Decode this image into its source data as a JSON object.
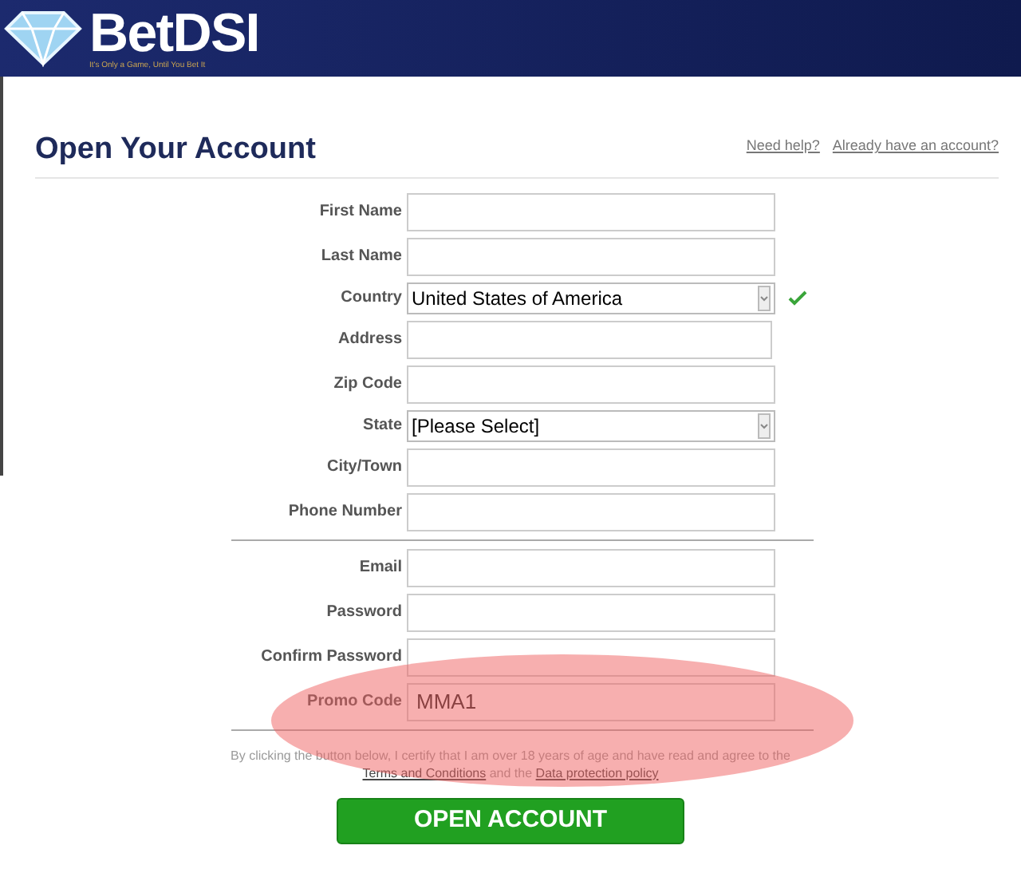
{
  "header": {
    "brand": "BetDSI",
    "tagline": "It's Only a Game, Until You Bet It"
  },
  "title": "Open Your Account",
  "links": [
    "Need help?",
    "Already have an account?"
  ],
  "groups": [
    [
      {
        "label": "First Name",
        "kind": "text"
      },
      {
        "label": "Last Name",
        "kind": "text"
      },
      {
        "label": "Country",
        "kind": "select",
        "value": "United States of America",
        "valid": true
      },
      {
        "label": "Address",
        "kind": "textarea"
      },
      {
        "label": "Zip Code",
        "kind": "text"
      },
      {
        "label": "State",
        "kind": "select",
        "value": "[Please Select]",
        "valid": false
      },
      {
        "label": "City/Town",
        "kind": "text"
      },
      {
        "label": "Phone Number",
        "kind": "text"
      }
    ],
    [
      {
        "label": "Email",
        "kind": "text"
      },
      {
        "label": "Password",
        "kind": "text"
      },
      {
        "label": "Confirm Password",
        "kind": "text"
      },
      {
        "label": "Promo Code",
        "kind": "text",
        "value": "MMA1"
      }
    ]
  ],
  "disclaimer": [
    {
      "kind": "text",
      "text": "By clicking the button below, I certify that I am over 18 years of age and have read and agree to the"
    },
    {
      "kind": "link",
      "text": "Terms and Conditions"
    },
    {
      "kind": "text",
      "text": "and the"
    },
    {
      "kind": "link",
      "text": "Data protection policy"
    }
  ],
  "submit": "OPEN ACCOUNT"
}
